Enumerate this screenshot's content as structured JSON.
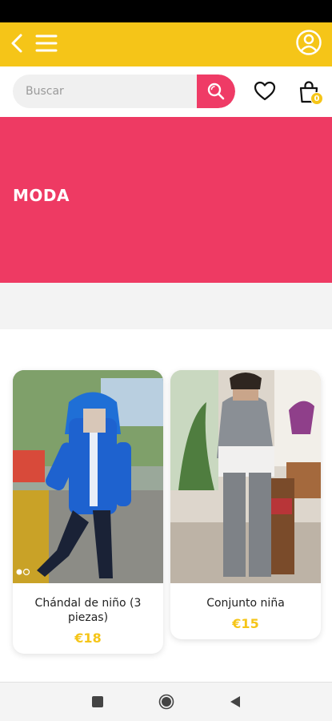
{
  "colors": {
    "accent_yellow": "#f5c518",
    "accent_pink": "#ee3a63",
    "search_button": "#ef3b66"
  },
  "topbar": {
    "icons": [
      "chevron-left-icon",
      "hamburger-menu-icon",
      "user-account-icon"
    ]
  },
  "search": {
    "placeholder": "Buscar",
    "value": "",
    "icon": "search-icon"
  },
  "actions": {
    "wishlist_icon": "heart-icon",
    "cart_icon": "shopping-bag-icon",
    "cart_count": "0"
  },
  "hero": {
    "title": "MODA"
  },
  "products": [
    {
      "title": "Chándal de niño (3 piezas)",
      "price": "€18"
    },
    {
      "title": "Conjunto niña",
      "price": "€15"
    }
  ],
  "android_nav": {
    "icons": [
      "recent-apps-icon",
      "home-icon",
      "back-icon"
    ]
  }
}
